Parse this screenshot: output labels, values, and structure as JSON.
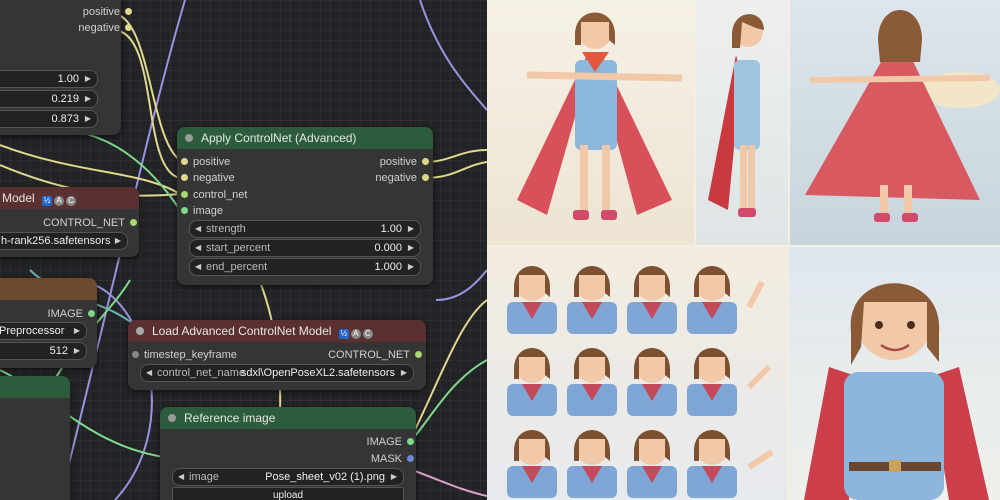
{
  "colors": {
    "node_bg": "#353535",
    "apply_header": "#2c5c3b",
    "load_header": "#5a3030",
    "ref_header": "#2c5c3b",
    "orange_header": "#6b4a2e",
    "socket_positive": "#e0d88c",
    "socket_image": "#7fd98a",
    "socket_control_net": "#a8d870",
    "socket_mask": "#6c8ad8"
  },
  "top_node": {
    "out_positive": "positive",
    "out_negative": "negative",
    "w1_value": "1.00",
    "w2_value": "0.219",
    "w3_value": "0.873"
  },
  "apply_controlnet": {
    "title": "Apply ControlNet (Advanced)",
    "inputs": [
      "positive",
      "negative",
      "control_net",
      "image"
    ],
    "outputs": [
      "positive",
      "negative"
    ],
    "strength_label": "strength",
    "strength_value": "1.00",
    "start_label": "start_percent",
    "start_value": "0.000",
    "end_label": "end_percent",
    "end_value": "1.000"
  },
  "left_model_node": {
    "title": "Model",
    "out_control_net": "CONTROL_NET",
    "widget_value": "h-rank256.safetensors"
  },
  "preproc_node": {
    "out_image": "IMAGE",
    "widget1_value": "Preprocessor",
    "widget2_value": "512"
  },
  "load_adv_controlnet": {
    "title": "Load Advanced ControlNet Model",
    "input_timestep": "timestep_keyframe",
    "output": "CONTROL_NET",
    "widget_label": "control_net_name",
    "widget_value": "sdxl\\OpenPoseXL2.safetensors"
  },
  "reference_image": {
    "title": "Reference image",
    "out_image": "IMAGE",
    "out_mask": "MASK",
    "widget_label": "image",
    "widget_value": "Pose_sheet_v02 (1).png",
    "upload_label": "upload"
  },
  "badges": {
    "b1": "½",
    "b2": "A",
    "b3": "C"
  },
  "icons": [
    "dropdown-arrow-left-icon",
    "dropdown-arrow-right-icon",
    "node-collapse-dot-icon",
    "badge-icon"
  ]
}
